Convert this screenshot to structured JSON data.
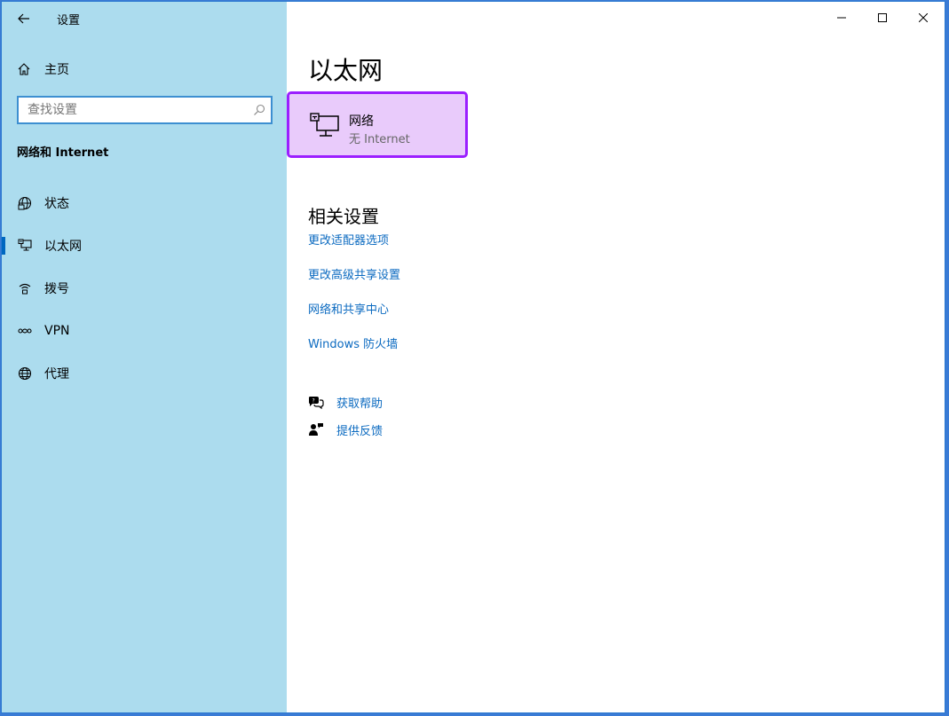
{
  "window": {
    "title": "设置",
    "controls": {
      "minimize": "minimize-icon",
      "maximize": "maximize-icon",
      "close": "close-icon"
    }
  },
  "sidebar": {
    "home_label": "主页",
    "search_placeholder": "查找设置",
    "section_title": "网络和 Internet",
    "items": [
      {
        "label": "状态",
        "icon": "globe-status-icon",
        "active": false
      },
      {
        "label": "以太网",
        "icon": "ethernet-icon",
        "active": true
      },
      {
        "label": "拨号",
        "icon": "dialup-icon",
        "active": false
      },
      {
        "label": "VPN",
        "icon": "vpn-icon",
        "active": false
      },
      {
        "label": "代理",
        "icon": "globe-icon",
        "active": false
      }
    ]
  },
  "main": {
    "title": "以太网",
    "network_card": {
      "name": "网络",
      "status": "无 Internet",
      "icon": "ethernet-network-icon"
    },
    "related_title": "相关设置",
    "related_links": [
      "更改适配器选项",
      "更改高级共享设置",
      "网络和共享中心",
      "Windows 防火墙"
    ],
    "help": {
      "get_help": "获取帮助",
      "feedback": "提供反馈"
    }
  },
  "colors": {
    "sidebar_bg": "#acdcee",
    "accent": "#0067c0",
    "link": "#0b6ac0",
    "card_bg": "#e9cbfb",
    "card_border": "#9b1fff"
  }
}
